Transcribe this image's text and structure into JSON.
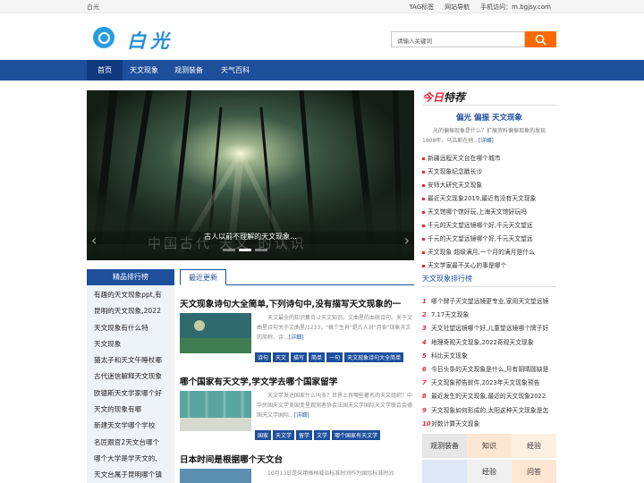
{
  "topbar": {
    "site": "白光",
    "links": [
      "TAG标签",
      "网站导航",
      "手机访问：m.bgjsy.com"
    ]
  },
  "header": {
    "logo_text": "白光",
    "search_placeholder": "请输入关键词",
    "search_icon": "search-icon"
  },
  "nav": [
    "首页",
    "天文现象",
    "观测装备",
    "天气百科"
  ],
  "banner": {
    "caption": "古人以前不理解的天文现象...",
    "overlay_text": "中国古代 天文 的认识"
  },
  "today": {
    "title_a": "今日",
    "title_b": "特荐",
    "headline": "偏光 偏振 天文现象",
    "desc": "光的偏振现象是什么？扩展资料偏振现象的发现1808年，马吕斯在他...",
    "more": "[详细]",
    "items": [
      "新疆远程天文台在哪个城市",
      "天文现象纪念戳长沙",
      "安师大研究天文现象",
      "最近天文现象2019,最近有没有天文现象",
      "天文馆哪个馆好玩,上海天文馆好玩吗",
      "千元的天文望远镜哪个好,千元天文望远",
      "千元的天文望远镜哪个好,千元天文望远",
      "天文现象 超级满月,一个月的满月是什么",
      "天文学家最不关心的事是哪个"
    ]
  },
  "rank_right": {
    "title": "天文现象排行榜",
    "items": [
      "哪个牌子天文望远镜更专业,家用天文望远镜",
      "7.17天文现象",
      "天文社望远镜哪个好,儿童望远镜哪个牌子好",
      "地理奇观天文现象,2022奇观天文现象",
      "科比天文现象",
      "今日头条的天文现象是什么,月有阴晴圆缺是",
      "天文现象预告软件,2023年天文现象预告",
      "最近发生的天文现象,最近的天文现象2022",
      "天文现象如何形成的,太阳这种天文现象是怎",
      "对数计算天文现象"
    ]
  },
  "tags": [
    [
      "观测装备",
      "知识",
      "经验"
    ],
    [
      "",
      "经验",
      "问答"
    ]
  ],
  "rank_left": {
    "title": "精品排行榜",
    "items": [
      "有趣的天文现象ppt,有",
      "昆明的天文现象,2022",
      "天文现象有什么特",
      "天文现象",
      "猫太子和天文午睡杖哪",
      "古代迷信解释天文现象",
      "欧德斯天文学家哪个好",
      "天文的现象有哪",
      "新建天文学哪个学校",
      "名匠跟官2天文台哪个",
      "哪个大学是学天文的,",
      "天文台属于昆明哪个镇"
    ]
  },
  "latest": {
    "tab": "最近更新",
    "articles": [
      {
        "title": "天文现象诗句大全简单,下列诗句中,没有描写天文现象的一",
        "desc": "天文最全的知识集合-2天文知识。文曲星的血统诗句。关于文曲星诗句关于文曲星/1233，\"搞个生肖\"是古人对\"月食\"现象天文的简称、诗...",
        "more": "[详细]",
        "tags": [
          "诗句",
          "天文",
          "描写",
          "简单",
          "一句",
          "天文现象诗句大全简单"
        ],
        "thumb_text": "天文现象诗句大全 描写天文 的诗句"
      },
      {
        "title": "哪个国家有天文学,学文学去哪个国家留学",
        "desc": "天文学发达国家什么叫多？世界上有哪些著名的天文组织？中华民国天文学美国变星观测者协会法国天文学国际天文学联合会德国天文学国际...",
        "more": "[详细]",
        "tags": [
          "国家",
          "天文学",
          "留学",
          "文学",
          "哪个国家有天文学"
        ],
        "thumb_text": ""
      },
      {
        "title": "日本时间是根据哪个天文台",
        "desc": "10月13日是采用格林威治标准时间作为国际标准时间",
        "more": "",
        "tags": [],
        "thumb_text": ""
      }
    ]
  },
  "colors": {
    "brand": "#1d4f9b",
    "accent": "#ff6a00",
    "logo": "#2a9de0",
    "red": "#e23"
  }
}
